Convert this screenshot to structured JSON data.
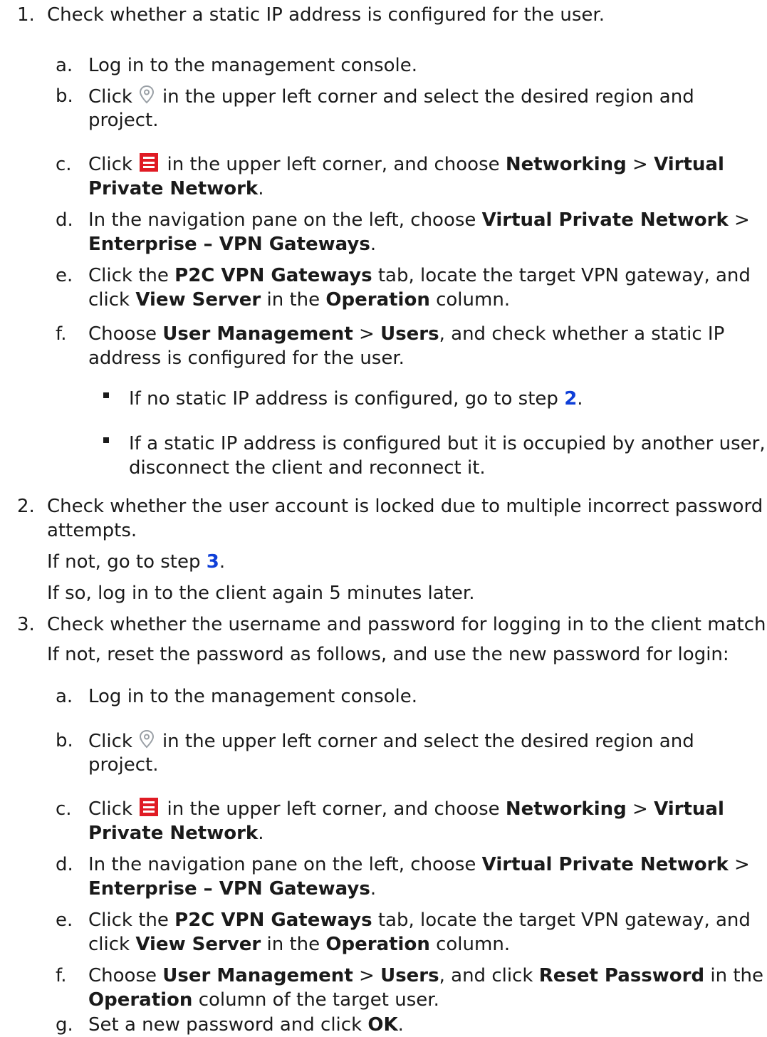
{
  "steps": [
    {
      "num": "1.",
      "text": "Check whether a static IP address is configured for the user.",
      "substeps": [
        {
          "letter": "a.",
          "text": "Log in to the management console."
        },
        {
          "letter": "b.",
          "pre": "Click",
          "post": "in the upper left corner and select the desired region and",
          "cont": "project."
        },
        {
          "letter": "c.",
          "pre": "Click",
          "post": "in the upper left corner, and choose",
          "b1": "Networking",
          "sep": ">",
          "b2": "Virtual",
          "b3": "Private Network",
          "end": "."
        },
        {
          "letter": "d.",
          "pre": "In the navigation pane on the left, choose",
          "b1": "Virtual Private Network",
          "sep": ">",
          "b2": "Enterprise – VPN Gateways",
          "end": "."
        },
        {
          "letter": "e.",
          "pre": "Click the",
          "b1": "P2C VPN Gateways",
          "mid": "tab, locate the target VPN gateway, and",
          "pre2": "click",
          "b2": "View Server",
          "mid2": "in the",
          "b3": "Operation",
          "end": "column."
        },
        {
          "letter": "f.",
          "pre": "Choose",
          "b1": "User Management",
          "sep": ">",
          "b2": "Users",
          "mid": ", and check whether a static IP",
          "cont": "address is configured for the user."
        }
      ],
      "bullets": [
        {
          "pre": "If no static IP address is configured, go to step",
          "link": "2",
          "end": "."
        },
        {
          "text": "If a static IP address is configured but it is occupied by another user,",
          "cont": "disconnect the client and reconnect it."
        }
      ]
    },
    {
      "num": "2.",
      "text": "Check whether the user account is locked due to multiple incorrect password",
      "cont": "attempts.",
      "p1_pre": "If not, go to step",
      "p1_link": "3",
      "p1_end": ".",
      "p2": "If so, log in to the client again 5 minutes later."
    },
    {
      "num": "3.",
      "text": "Check whether the username and password for logging in to the client match.",
      "p1": "If not, reset the password as follows, and use the new password for login:",
      "substeps": [
        {
          "letter": "a.",
          "text": "Log in to the management console."
        },
        {
          "letter": "b.",
          "pre": "Click",
          "post": "in the upper left corner and select the desired region and",
          "cont": "project."
        },
        {
          "letter": "c.",
          "pre": "Click",
          "post": "in the upper left corner, and choose",
          "b1": "Networking",
          "sep": ">",
          "b2": "Virtual",
          "b3": "Private Network",
          "end": "."
        },
        {
          "letter": "d.",
          "pre": "In the navigation pane on the left, choose",
          "b1": "Virtual Private Network",
          "sep": ">",
          "b2": "Enterprise – VPN Gateways",
          "end": "."
        },
        {
          "letter": "e.",
          "pre": "Click the",
          "b1": "P2C VPN Gateways",
          "mid": "tab, locate the target VPN gateway, and",
          "pre2": "click",
          "b2": "View Server",
          "mid2": "in the",
          "b3": "Operation",
          "end": "column."
        },
        {
          "letter": "f.",
          "pre": "Choose",
          "b1": "User Management",
          "sep": ">",
          "b2": "Users",
          "mid": ", and click",
          "b3": "Reset Password",
          "end": "in the",
          "b4": "Operation",
          "end2": "column of the target user."
        },
        {
          "letter": "g.",
          "pre": "Set a new password and click",
          "b1": "OK",
          "end": "."
        }
      ]
    }
  ],
  "icons": {
    "location": "location-pin-icon",
    "menu": "service-list-menu-icon",
    "menu_color": "#e01b24",
    "link_color": "#0f3fd8"
  }
}
